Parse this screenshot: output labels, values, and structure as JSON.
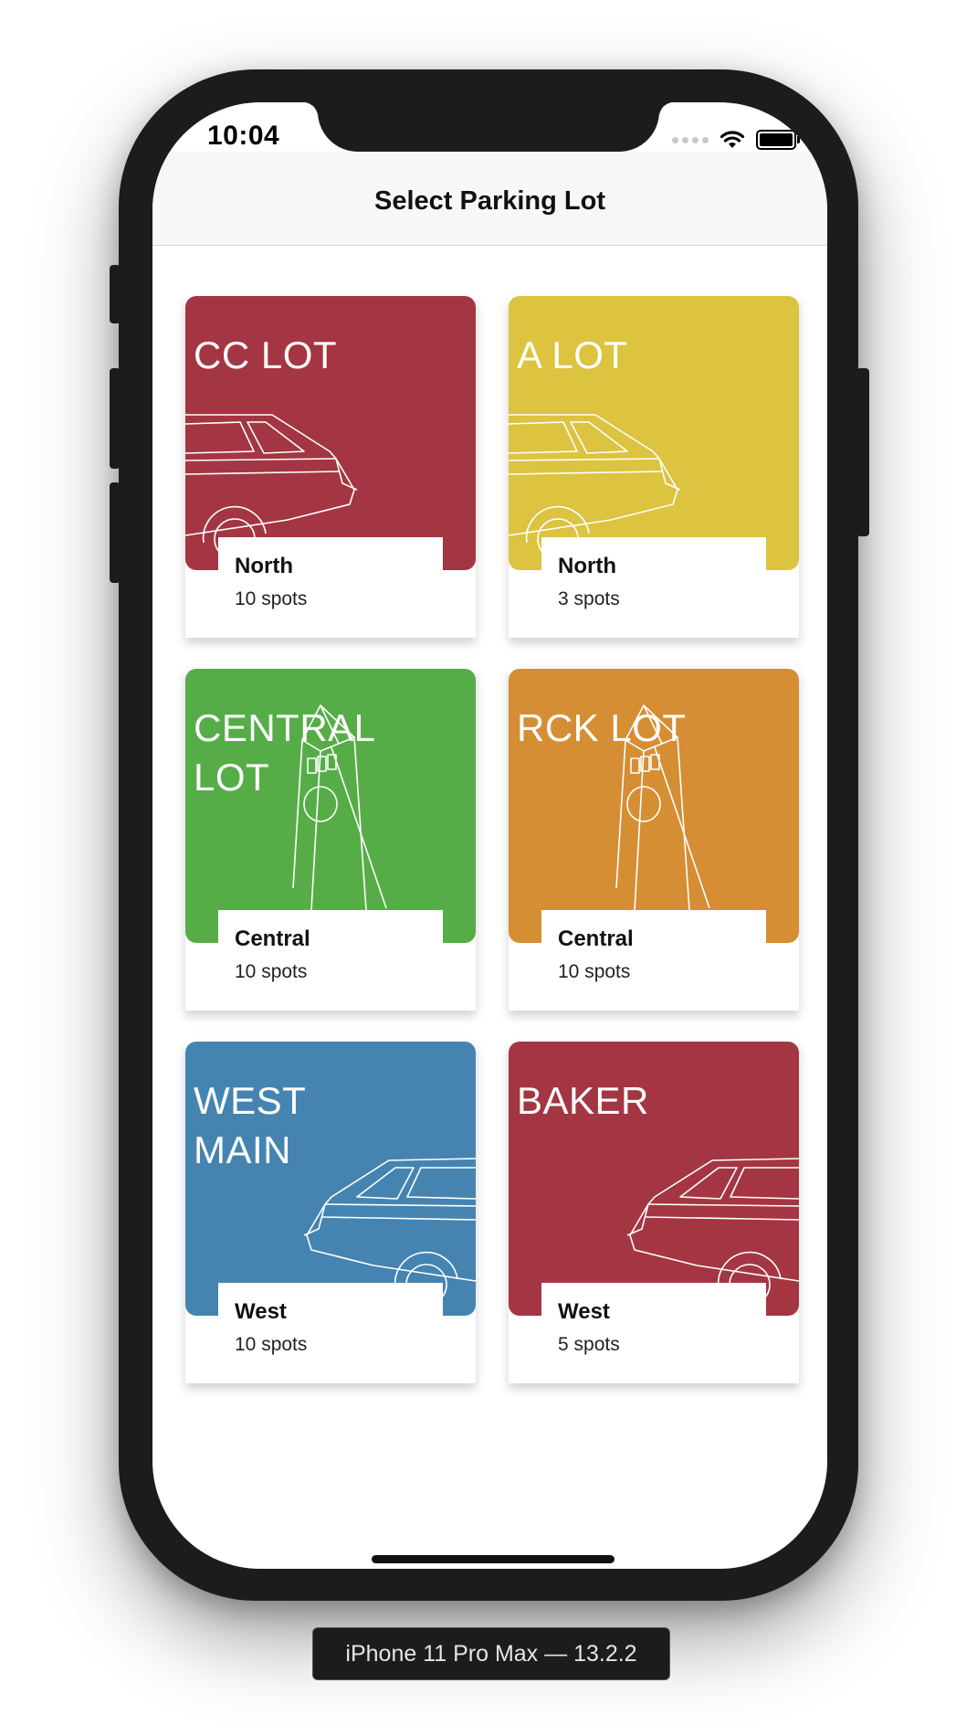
{
  "status_bar": {
    "time": "10:04"
  },
  "nav": {
    "title": "Select Parking Lot"
  },
  "lots": [
    {
      "title": "CC LOT",
      "region": "North",
      "spots": "10 spots",
      "color": "#a33642",
      "art": "car-icon"
    },
    {
      "title": "A LOT",
      "region": "North",
      "spots": "3 spots",
      "color": "#dcc340",
      "art": "car-icon"
    },
    {
      "title": "CENTRAL\nLOT",
      "region": "Central",
      "spots": "10 spots",
      "color": "#56ad47",
      "art": "clock-tower-icon"
    },
    {
      "title": "RCK LOT",
      "region": "Central",
      "spots": "10 spots",
      "color": "#d58e33",
      "art": "clock-tower-icon"
    },
    {
      "title": "WEST\nMAIN",
      "region": "West",
      "spots": "10 spots",
      "color": "#4584b0",
      "art": "car-icon"
    },
    {
      "title": "BAKER",
      "region": "West",
      "spots": "5 spots",
      "color": "#a33642",
      "art": "car-icon"
    }
  ],
  "device": {
    "label": "iPhone 11 Pro Max — 13.2.2"
  }
}
